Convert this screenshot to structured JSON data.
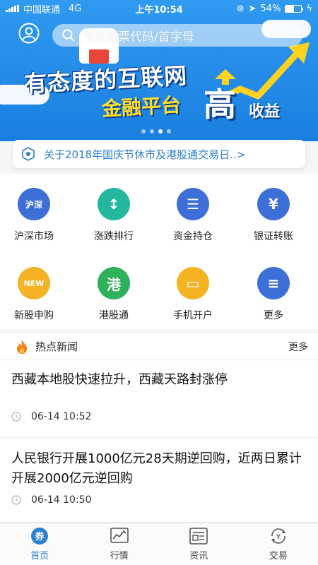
{
  "status_bar": {
    "carrier": "中国联通",
    "network": "4G",
    "time": "上午10:54",
    "battery": "54%",
    "battery_level": 0.54
  },
  "banner": {
    "search_placeholder": "搜索股票代码/首字母",
    "slogan_line1": "有态度的互联网",
    "slogan_line2": "金融平台",
    "slogan_big": "高",
    "slogan_small": "收益",
    "dot_count": 4,
    "active_dot": 2
  },
  "notice": {
    "text": "关于2018年国庆节休市及港股通交易日..>"
  },
  "grid": {
    "items": [
      {
        "label": "沪深市场",
        "icon": "hushen-icon",
        "color": "#3d6fd8",
        "glyph": "沪深"
      },
      {
        "label": "涨跌排行",
        "icon": "updown-icon",
        "color": "#23b89e",
        "glyph": "↕"
      },
      {
        "label": "资金持仓",
        "icon": "coins-icon",
        "color": "#3d6fd8",
        "glyph": "☰"
      },
      {
        "label": "银证转账",
        "icon": "bank-card-icon",
        "color": "#3d6fd8",
        "glyph": "¥"
      },
      {
        "label": "新股申购",
        "icon": "new-stock-icon",
        "color": "#f5b324",
        "glyph": "NEW"
      },
      {
        "label": "港股通",
        "icon": "hk-icon",
        "color": "#2fb05a",
        "glyph": "港"
      },
      {
        "label": "手机开户",
        "icon": "card-icon",
        "color": "#f5b324",
        "glyph": "▭"
      },
      {
        "label": "更多",
        "icon": "more-icon",
        "color": "#3d6fd8",
        "glyph": "≡"
      }
    ]
  },
  "news": {
    "title": "热点新闻",
    "more": "更多",
    "items": [
      {
        "headline": "西藏本地股快速拉升，西藏天路封涨停",
        "time": "06-14 10:52"
      },
      {
        "headline": "人民银行开展1000亿元28天期逆回购，近两日累计开展2000亿元逆回购",
        "time": "06-14 10:50"
      }
    ]
  },
  "tabbar": {
    "tabs": [
      {
        "label": "首页",
        "icon": "home-quan-icon",
        "active": true
      },
      {
        "label": "行情",
        "icon": "chart-icon",
        "active": false
      },
      {
        "label": "资讯",
        "icon": "news-icon",
        "active": false
      },
      {
        "label": "交易",
        "icon": "trade-icon",
        "active": false
      }
    ]
  },
  "colors": {
    "brand_blue": "#1f8ae8",
    "accent": "#2d7fd0",
    "slogan_yellow": "#ffde2a"
  }
}
